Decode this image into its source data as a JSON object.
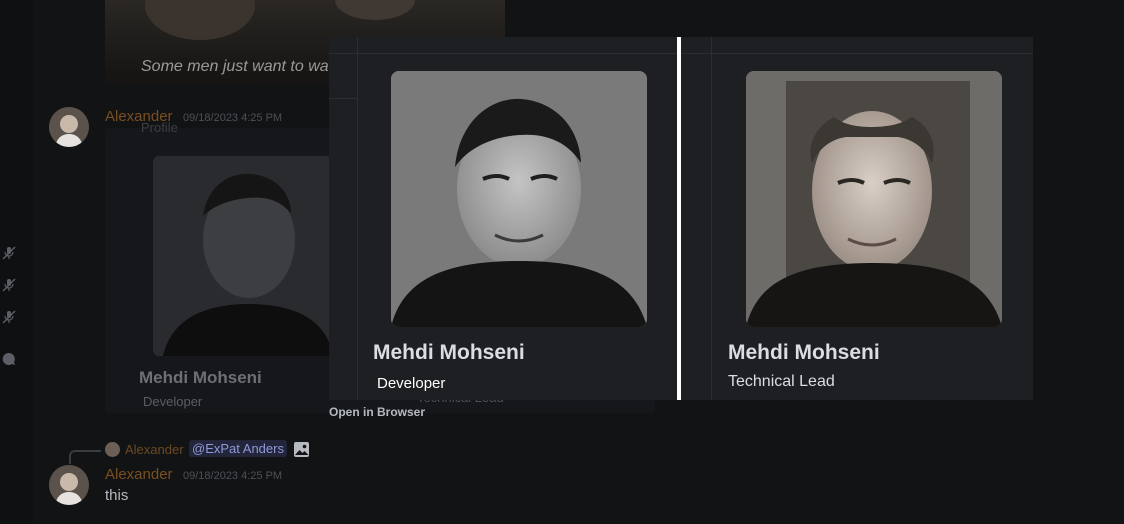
{
  "image_caption": "Some men just want to wa",
  "messages": [
    {
      "author": "Alexander",
      "timestamp": "09/18/2023 4:25 PM"
    },
    {
      "author": "Alexander",
      "timestamp": "09/18/2023 4:25 PM",
      "text": "this"
    }
  ],
  "reply": {
    "author": "Alexander",
    "mention": "@ExPat Anders",
    "icon": "image-icon"
  },
  "embed_background": {
    "title_fragment": "Profile",
    "name": "Mehdi Mohseni",
    "role_left": "Developer",
    "role_right": "Technical Lead"
  },
  "open_in_browser": "Open in Browser",
  "comparison": {
    "left": {
      "name": "Mehdi Mohseni",
      "role": "Developer"
    },
    "right": {
      "name": "Mehdi Mohseni",
      "role": "Technical Lead"
    }
  },
  "colors": {
    "username": "#7a4f20",
    "mention_text": "#8f98d8",
    "divider": "#ffffff"
  },
  "icons": [
    "mic-muted-icon",
    "mic-muted-icon",
    "mic-muted-icon",
    "chat-bubble-icon",
    "image-icon"
  ]
}
